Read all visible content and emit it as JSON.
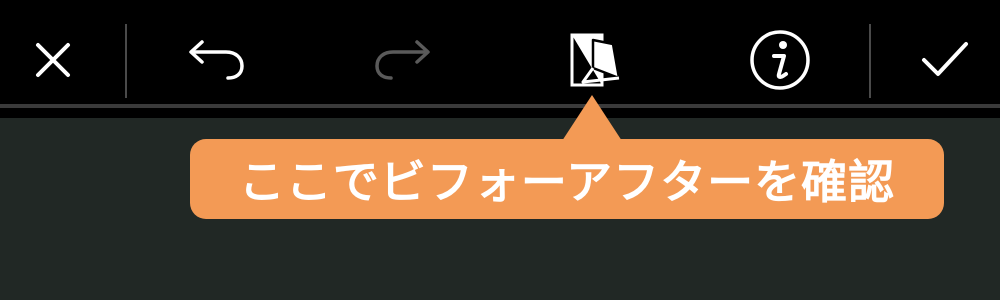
{
  "toolbar": {
    "buttons": [
      {
        "icon": "close-icon",
        "enabled": true
      },
      {
        "icon": "undo-icon",
        "enabled": true
      },
      {
        "icon": "redo-icon",
        "enabled": false
      },
      {
        "icon": "compare-icon",
        "enabled": true
      },
      {
        "icon": "info-icon",
        "enabled": true
      },
      {
        "icon": "checkmark-icon",
        "enabled": true
      }
    ],
    "colors": {
      "icon": "#ffffff",
      "disabled_icon": "#5a5a5a",
      "background": "#000000"
    }
  },
  "tooltip": {
    "text": "ここでビフォーアフターを確認",
    "color": "#f39a55"
  },
  "canvas": {
    "background": "#212825"
  }
}
